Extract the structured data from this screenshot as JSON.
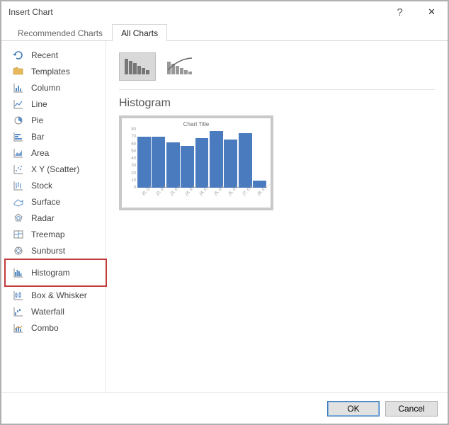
{
  "titlebar": {
    "title": "Insert Chart",
    "help_glyph": "?",
    "close_glyph": "✕"
  },
  "tabs": {
    "recommended": "Recommended Charts",
    "all": "All Charts"
  },
  "sidebar": {
    "items": [
      {
        "label": "Recent"
      },
      {
        "label": "Templates"
      },
      {
        "label": "Column"
      },
      {
        "label": "Line"
      },
      {
        "label": "Pie"
      },
      {
        "label": "Bar"
      },
      {
        "label": "Area"
      },
      {
        "label": "X Y (Scatter)"
      },
      {
        "label": "Stock"
      },
      {
        "label": "Surface"
      },
      {
        "label": "Radar"
      },
      {
        "label": "Treemap"
      },
      {
        "label": "Sunburst"
      },
      {
        "label": "Histogram"
      },
      {
        "label": "Box & Whisker"
      },
      {
        "label": "Waterfall"
      },
      {
        "label": "Combo"
      }
    ]
  },
  "main": {
    "subtype_title": "Histogram",
    "preview_title": "Chart Title"
  },
  "chart_data": {
    "type": "bar",
    "categories": [
      "[0, 0.4…",
      "[2, 0.4…",
      "[3, 0.4…",
      "[4, 0.4…",
      "[4, 0.4…",
      "[5, 0.4…",
      "[6, 0.4…",
      "[7, 0.4…",
      "[8, 0.4…"
    ],
    "values": [
      70,
      70,
      62,
      58,
      68,
      78,
      66,
      75,
      10
    ],
    "yticks": [
      0,
      10,
      20,
      30,
      40,
      50,
      60,
      70,
      80
    ],
    "ylim": [
      0,
      80
    ],
    "title": "Chart Title",
    "xlabel": "",
    "ylabel": ""
  },
  "footer": {
    "ok": "OK",
    "cancel": "Cancel"
  },
  "colors": {
    "bar": "#4a7bbf",
    "highlight_border": "#c23a3a"
  }
}
